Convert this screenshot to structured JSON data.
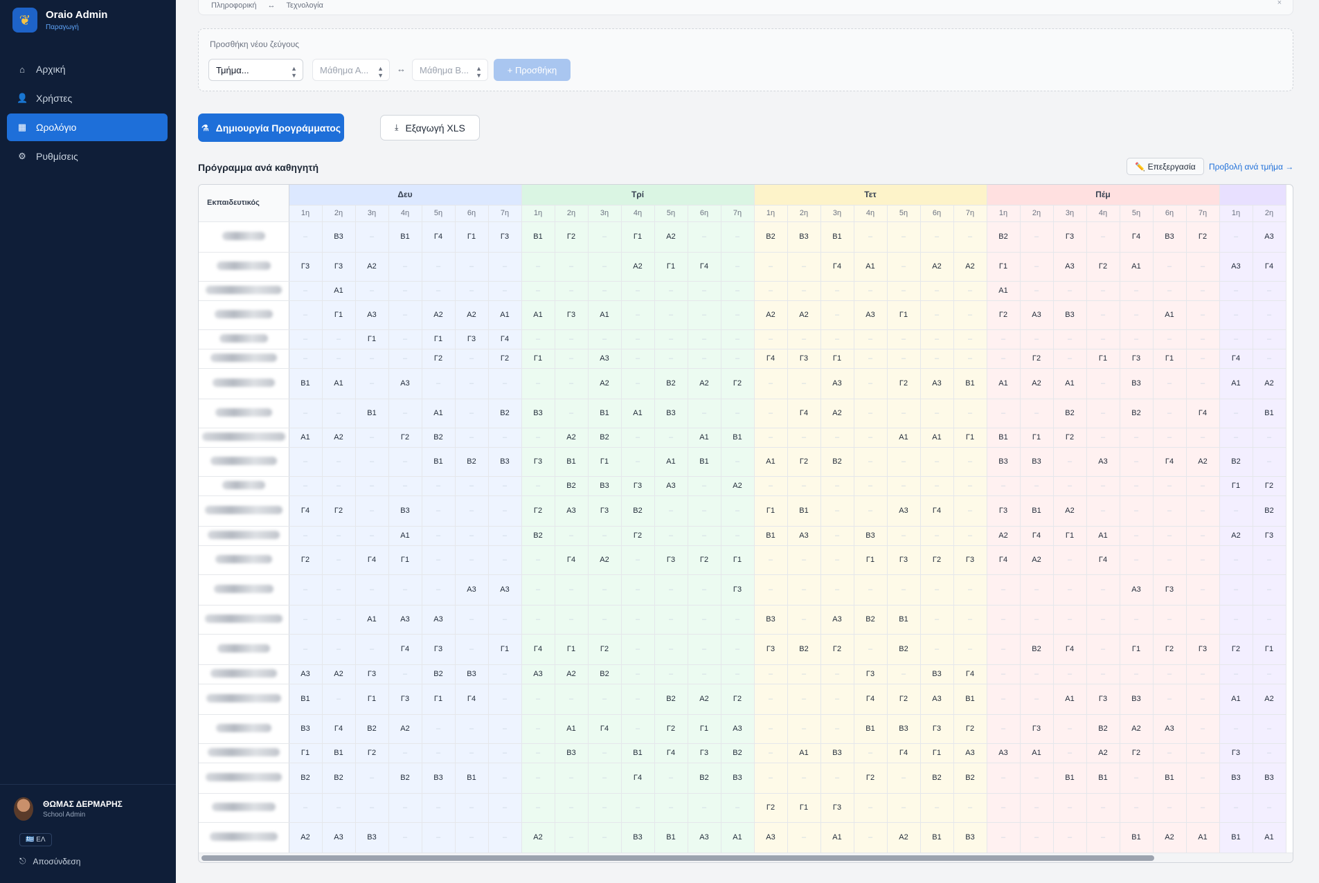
{
  "app": {
    "title": "Oraio Admin",
    "env": "Παραγωγή"
  },
  "nav": [
    {
      "label": "Αρχική",
      "icon": "home-icon",
      "active": false
    },
    {
      "label": "Χρήστες",
      "icon": "users-icon",
      "active": false
    },
    {
      "label": "Ωρολόγιο",
      "icon": "calendar-icon",
      "active": true
    },
    {
      "label": "Ρυθμίσεις",
      "icon": "gear-icon",
      "active": false
    }
  ],
  "user": {
    "name": "ΘΩΜΑΣ ΔΕΡΜΑΡΗΣ",
    "role": "School Admin",
    "lang": "🇬🇷 ΕΛ",
    "logout": "Αποσύνδεση"
  },
  "pair": {
    "a": "Πληροφορική",
    "arrow": "↔",
    "b": "Τεχνολογία",
    "close": "×"
  },
  "add_pair": {
    "label": "Προσθήκη νέου ζεύγους",
    "class_select": "Τμήμα...",
    "subject_a": "Μάθημα Α...",
    "swap": "↔",
    "subject_b": "Μάθημα Β...",
    "add_button": "+ Προσθήκη"
  },
  "actions": {
    "generate": "Δημιουργία Προγράμματος",
    "export": "Εξαγωγή XLS"
  },
  "schedule": {
    "title": "Πρόγραμμα ανά καθηγητή",
    "edit": "✏️ Επεξεργασία",
    "view_by_class": "Προβολή ανά τμήμα →",
    "teacher_header": "Εκπαιδευτικός",
    "days": [
      "Δευ",
      "Τρί",
      "Τετ",
      "Πέμ",
      ""
    ],
    "periods": [
      "1η",
      "2η",
      "3η",
      "4η",
      "5η",
      "6η",
      "7η"
    ],
    "last_periods": [
      "1η",
      "2η"
    ],
    "empty": "–",
    "rows": [
      {
        "h": 44,
        "c": [
          "-",
          "Β3",
          "-",
          "Β1",
          "Γ4",
          "Γ1",
          "Γ3",
          "Β1",
          "Γ2",
          "-",
          "Γ1",
          "Α2",
          "-",
          "-",
          "Β2",
          "Β3",
          "Β1",
          "-",
          "-",
          "-",
          "-",
          "Β2",
          "-",
          "Γ3",
          "-",
          "Γ4",
          "Β3",
          "Γ2",
          "-",
          "Α3"
        ]
      },
      {
        "h": 42,
        "c": [
          "Γ3",
          "Γ3",
          "Α2",
          "-",
          "-",
          "-",
          "-",
          "-",
          "-",
          "-",
          "Α2",
          "Γ1",
          "Γ4",
          "-",
          "-",
          "-",
          "Γ4",
          "Α1",
          "-",
          "Α2",
          "Α2",
          "Γ1",
          "-",
          "Α3",
          "Γ2",
          "Α1",
          "-",
          "-",
          "Α3",
          "Γ4"
        ]
      },
      {
        "h": 28,
        "c": [
          "-",
          "Α1",
          "-",
          "-",
          "-",
          "-",
          "-",
          "-",
          "-",
          "-",
          "-",
          "-",
          "-",
          "-",
          "-",
          "-",
          "-",
          "-",
          "-",
          "-",
          "-",
          "Α1",
          "-",
          "-",
          "-",
          "-",
          "-",
          "-",
          "-",
          "-"
        ]
      },
      {
        "h": 42,
        "c": [
          "-",
          "Γ1",
          "Α3",
          "-",
          "Α2",
          "Α2",
          "Α1",
          "Α1",
          "Γ3",
          "Α1",
          "-",
          "-",
          "-",
          "-",
          "Α2",
          "Α2",
          "-",
          "Α3",
          "Γ1",
          "-",
          "-",
          "Γ2",
          "Α3",
          "Β3",
          "-",
          "-",
          "Α1",
          "-",
          "-",
          "-"
        ]
      },
      {
        "h": 28,
        "c": [
          "-",
          "-",
          "Γ1",
          "-",
          "Γ1",
          "Γ3",
          "Γ4",
          "-",
          "-",
          "-",
          "-",
          "-",
          "-",
          "-",
          "-",
          "-",
          "-",
          "-",
          "-",
          "-",
          "-",
          "-",
          "-",
          "-",
          "-",
          "-",
          "-",
          "-",
          "-",
          "-"
        ]
      },
      {
        "h": 28,
        "c": [
          "-",
          "-",
          "-",
          "-",
          "Γ2",
          "-",
          "Γ2",
          "Γ1",
          "-",
          "Α3",
          "-",
          "-",
          "-",
          "-",
          "Γ4",
          "Γ3",
          "Γ1",
          "-",
          "-",
          "-",
          "-",
          "-",
          "Γ2",
          "-",
          "Γ1",
          "Γ3",
          "Γ1",
          "-",
          "Γ4",
          "-"
        ]
      },
      {
        "h": 44,
        "c": [
          "Β1",
          "Α1",
          "-",
          "Α3",
          "-",
          "-",
          "-",
          "-",
          "-",
          "Α2",
          "-",
          "Β2",
          "Α2",
          "Γ2",
          "-",
          "-",
          "Α3",
          "-",
          "Γ2",
          "Α3",
          "Β1",
          "Α1",
          "Α2",
          "Α1",
          "-",
          "Β3",
          "-",
          "-",
          "Α1",
          "Α2"
        ]
      },
      {
        "h": 42,
        "c": [
          "-",
          "-",
          "Β1",
          "-",
          "Α1",
          "-",
          "Β2",
          "Β3",
          "-",
          "Β1",
          "Α1",
          "Β3",
          "-",
          "-",
          "-",
          "Γ4",
          "Α2",
          "-",
          "-",
          "-",
          "-",
          "-",
          "-",
          "Β2",
          "-",
          "Β2",
          "-",
          "Γ4",
          "-",
          "Β1"
        ]
      },
      {
        "h": 28,
        "c": [
          "Α1",
          "Α2",
          "-",
          "Γ2",
          "Β2",
          "-",
          "-",
          "-",
          "Α2",
          "Β2",
          "-",
          "-",
          "Α1",
          "Β1",
          "-",
          "-",
          "-",
          "-",
          "Α1",
          "Α1",
          "Γ1",
          "Β1",
          "Γ1",
          "Γ2",
          "-",
          "-",
          "-",
          "-",
          "-",
          "-"
        ]
      },
      {
        "h": 42,
        "c": [
          "-",
          "-",
          "-",
          "-",
          "Β1",
          "Β2",
          "Β3",
          "Γ3",
          "Β1",
          "Γ1",
          "-",
          "Α1",
          "Β1",
          "-",
          "Α1",
          "Γ2",
          "Β2",
          "-",
          "-",
          "-",
          "-",
          "Β3",
          "Β3",
          "-",
          "Α3",
          "-",
          "Γ4",
          "Α2",
          "Β2",
          "-"
        ]
      },
      {
        "h": 28,
        "c": [
          "-",
          "-",
          "-",
          "-",
          "-",
          "-",
          "-",
          "-",
          "Β2",
          "Β3",
          "Γ3",
          "Α3",
          "-",
          "Α2",
          "-",
          "-",
          "-",
          "-",
          "-",
          "-",
          "-",
          "-",
          "-",
          "-",
          "-",
          "-",
          "-",
          "-",
          "Γ1",
          "Γ2"
        ]
      },
      {
        "h": 44,
        "c": [
          "Γ4",
          "Γ2",
          "-",
          "Β3",
          "-",
          "-",
          "-",
          "Γ2",
          "Α3",
          "Γ3",
          "Β2",
          "-",
          "-",
          "-",
          "Γ1",
          "Β1",
          "-",
          "-",
          "Α3",
          "Γ4",
          "-",
          "Γ3",
          "Β1",
          "Α2",
          "-",
          "-",
          "-",
          "-",
          "-",
          "Β2"
        ]
      },
      {
        "h": 28,
        "c": [
          "-",
          "-",
          "-",
          "Α1",
          "-",
          "-",
          "-",
          "Β2",
          "-",
          "-",
          "Γ2",
          "-",
          "-",
          "-",
          "Β1",
          "Α3",
          "-",
          "Β3",
          "-",
          "-",
          "-",
          "Α2",
          "Γ4",
          "Γ1",
          "Α1",
          "-",
          "-",
          "-",
          "Α2",
          "Γ3"
        ]
      },
      {
        "h": 42,
        "c": [
          "Γ2",
          "-",
          "Γ4",
          "Γ1",
          "-",
          "-",
          "-",
          "-",
          "Γ4",
          "Α2",
          "-",
          "Γ3",
          "Γ2",
          "Γ1",
          "-",
          "-",
          "-",
          "Γ1",
          "Γ3",
          "Γ2",
          "Γ3",
          "Γ4",
          "Α2",
          "-",
          "Γ4",
          "-",
          "-",
          "-",
          "-",
          "-"
        ]
      },
      {
        "h": 44,
        "c": [
          "-",
          "-",
          "-",
          "-",
          "-",
          "Α3",
          "Α3",
          "-",
          "-",
          "-",
          "-",
          "-",
          "-",
          "Γ3",
          "-",
          "-",
          "-",
          "-",
          "-",
          "-",
          "-",
          "-",
          "-",
          "-",
          "-",
          "Α3",
          "Γ3",
          "-",
          "-",
          "-"
        ]
      },
      {
        "h": 42,
        "c": [
          "-",
          "-",
          "Α1",
          "Α3",
          "Α3",
          "-",
          "-",
          "-",
          "-",
          "-",
          "-",
          "-",
          "-",
          "-",
          "Β3",
          "-",
          "Α3",
          "Β2",
          "Β1",
          "-",
          "-",
          "-",
          "-",
          "-",
          "-",
          "-",
          "-",
          "-",
          "-",
          "-"
        ]
      },
      {
        "h": 44,
        "c": [
          "-",
          "-",
          "-",
          "Γ4",
          "Γ3",
          "-",
          "Γ1",
          "Γ4",
          "Γ1",
          "Γ2",
          "-",
          "-",
          "-",
          "-",
          "Γ3",
          "Β2",
          "Γ2",
          "-",
          "Β2",
          "-",
          "-",
          "-",
          "Β2",
          "Γ4",
          "-",
          "Γ1",
          "Γ2",
          "Γ3",
          "Γ2",
          "Γ1"
        ]
      },
      {
        "h": 28,
        "c": [
          "Α3",
          "Α2",
          "Γ3",
          "-",
          "Β2",
          "Β3",
          "-",
          "Α3",
          "Α2",
          "Β2",
          "-",
          "-",
          "-",
          "-",
          "-",
          "-",
          "-",
          "Γ3",
          "-",
          "Β3",
          "Γ4",
          "-",
          "-",
          "-",
          "-",
          "-",
          "-",
          "-",
          "-",
          "-"
        ]
      },
      {
        "h": 44,
        "c": [
          "Β1",
          "-",
          "Γ1",
          "Γ3",
          "Γ1",
          "Γ4",
          "-",
          "-",
          "-",
          "-",
          "-",
          "Β2",
          "Α2",
          "Γ2",
          "-",
          "-",
          "-",
          "Γ4",
          "Γ2",
          "Α3",
          "Β1",
          "-",
          "-",
          "Α1",
          "Γ3",
          "Β3",
          "-",
          "-",
          "Α1",
          "Α2"
        ]
      },
      {
        "h": 42,
        "c": [
          "Β3",
          "Γ4",
          "Β2",
          "Α2",
          "-",
          "-",
          "-",
          "-",
          "Α1",
          "Γ4",
          "-",
          "Γ2",
          "Γ1",
          "Α3",
          "-",
          "-",
          "-",
          "Β1",
          "Β3",
          "Γ3",
          "Γ2",
          "-",
          "Γ3",
          "-",
          "Β2",
          "Α2",
          "Α3",
          "-",
          "-",
          "-"
        ]
      },
      {
        "h": 28,
        "c": [
          "Γ1",
          "Β1",
          "Γ2",
          "-",
          "-",
          "-",
          "-",
          "-",
          "Β3",
          "-",
          "Β1",
          "Γ4",
          "Γ3",
          "Β2",
          "-",
          "Α1",
          "Β3",
          "-",
          "Γ4",
          "Γ1",
          "Α3",
          "Α3",
          "Α1",
          "-",
          "Α2",
          "Γ2",
          "-",
          "-",
          "Γ3",
          "-"
        ]
      },
      {
        "h": 44,
        "c": [
          "Β2",
          "Β2",
          "-",
          "Β2",
          "Β3",
          "Β1",
          "-",
          "-",
          "-",
          "-",
          "Γ4",
          "-",
          "Β2",
          "Β3",
          "-",
          "-",
          "-",
          "Γ2",
          "-",
          "Β2",
          "Β2",
          "-",
          "-",
          "Β1",
          "Β1",
          "-",
          "Β1",
          "-",
          "Β3",
          "Β3"
        ]
      },
      {
        "h": 42,
        "c": [
          "-",
          "-",
          "-",
          "-",
          "-",
          "-",
          "-",
          "-",
          "-",
          "-",
          "-",
          "-",
          "-",
          "-",
          "Γ2",
          "Γ1",
          "Γ3",
          "-",
          "-",
          "-",
          "-",
          "-",
          "-",
          "-",
          "-",
          "-",
          "-",
          "-",
          "-",
          "-"
        ]
      },
      {
        "h": 44,
        "c": [
          "Α2",
          "Α3",
          "Β3",
          "-",
          "-",
          "-",
          "-",
          "Α2",
          "-",
          "-",
          "Β3",
          "Β1",
          "Α3",
          "Α1",
          "Α3",
          "-",
          "Α1",
          "-",
          "Α2",
          "Β1",
          "Β3",
          "-",
          "-",
          "-",
          "-",
          "Β1",
          "Α2",
          "Α1",
          "Β1",
          "Α1"
        ]
      }
    ]
  }
}
